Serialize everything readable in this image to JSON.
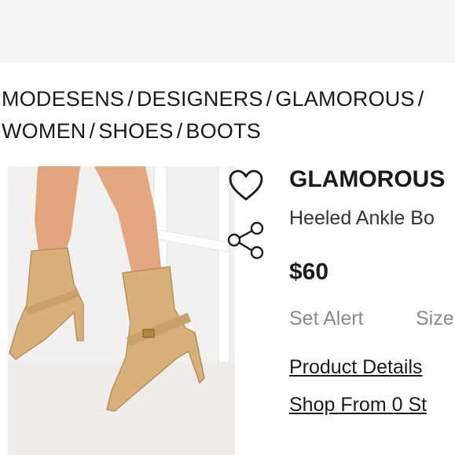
{
  "breadcrumb": {
    "items": [
      "MODESENS",
      "DESIGNERS",
      "GLAMOROUS",
      "WOMEN",
      "SHOES",
      "BOOTS"
    ],
    "separator": "/"
  },
  "product": {
    "brand": "GLAMOROUS",
    "title": "Heeled Ankle Bo",
    "price": "$60",
    "set_alert_label": "Set Alert",
    "size_label": "Size",
    "details_link": "Product Details",
    "shop_link": "Shop From 0 St",
    "image_subject": "tan croc-effect heeled ankle boots with buckle strap"
  },
  "icons": {
    "favorite": "heart-icon",
    "share": "share-icon"
  },
  "colors": {
    "text": "#1a1a1a",
    "muted": "#8a8a8a",
    "boot": "#d8b07a",
    "header_bg": "#f5f5f5"
  }
}
